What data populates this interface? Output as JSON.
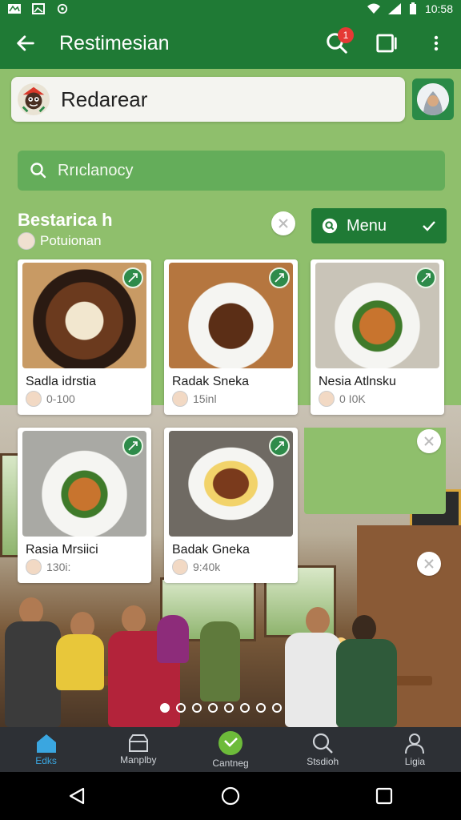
{
  "status_bar": {
    "time": "10:58"
  },
  "app_bar": {
    "title": "Restimesian",
    "notification_count": "1"
  },
  "search_top": {
    "label": "Redarear"
  },
  "search_second": {
    "placeholder": "Rrıclanocy"
  },
  "section": {
    "title": "Bestarica h",
    "subtitle": "Potuionan"
  },
  "menu_button": {
    "label": "Menu"
  },
  "cards": [
    {
      "name": "Sadla idrstia",
      "meta": "0-100"
    },
    {
      "name": "Radak Sneka",
      "meta": "15inl"
    },
    {
      "name": "Nesia Atlnsku",
      "meta": "0 I0K"
    },
    {
      "name": "Rasia Mrsiici",
      "meta": "130i:"
    },
    {
      "name": "Badak Gneka",
      "meta": "9:40k"
    }
  ],
  "carousel": {
    "count": 8,
    "active": 0
  },
  "bottom_nav": [
    {
      "label": "Edks",
      "icon": "home-icon",
      "active": true
    },
    {
      "label": "Manplby",
      "icon": "inbox-icon",
      "active": false
    },
    {
      "label": "Cantneg",
      "icon": "check-circle-icon",
      "active": false
    },
    {
      "label": "Stsdioh",
      "icon": "search-icon",
      "active": false
    },
    {
      "label": "Ligia",
      "icon": "person-icon",
      "active": false
    }
  ],
  "colors": {
    "primary": "#1f7a35",
    "background": "#8fbf6c",
    "accent": "#3aa6e0"
  }
}
